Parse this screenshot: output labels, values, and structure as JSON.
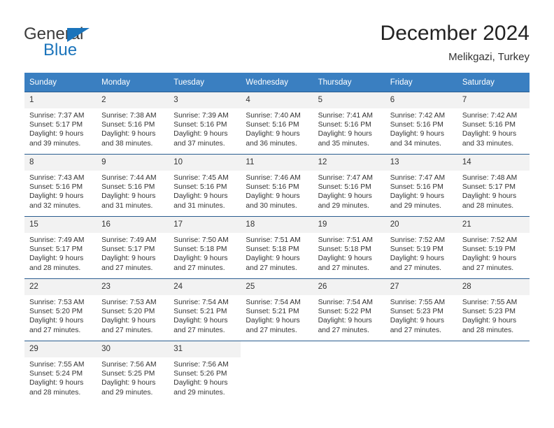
{
  "brand": {
    "name_top": "General",
    "name_bottom": "Blue",
    "top_color": "#3b3b3b",
    "accent_color": "#1b74bb",
    "triangle_icon": "triangle-right-icon"
  },
  "header": {
    "title": "December 2024",
    "subtitle": "Melikgazi, Turkey"
  },
  "theme": {
    "header_bg": "#3a7fc1",
    "header_text": "#ffffff",
    "daynum_bg": "#f2f2f2",
    "row_rule": "#2a5d8f",
    "body_text": "#333333"
  },
  "calendar": {
    "weekday_headers": [
      "Sunday",
      "Monday",
      "Tuesday",
      "Wednesday",
      "Thursday",
      "Friday",
      "Saturday"
    ],
    "weeks": [
      [
        {
          "day": "1",
          "sunrise": "Sunrise: 7:37 AM",
          "sunset": "Sunset: 5:17 PM",
          "daylight_1": "Daylight: 9 hours",
          "daylight_2": "and 39 minutes."
        },
        {
          "day": "2",
          "sunrise": "Sunrise: 7:38 AM",
          "sunset": "Sunset: 5:16 PM",
          "daylight_1": "Daylight: 9 hours",
          "daylight_2": "and 38 minutes."
        },
        {
          "day": "3",
          "sunrise": "Sunrise: 7:39 AM",
          "sunset": "Sunset: 5:16 PM",
          "daylight_1": "Daylight: 9 hours",
          "daylight_2": "and 37 minutes."
        },
        {
          "day": "4",
          "sunrise": "Sunrise: 7:40 AM",
          "sunset": "Sunset: 5:16 PM",
          "daylight_1": "Daylight: 9 hours",
          "daylight_2": "and 36 minutes."
        },
        {
          "day": "5",
          "sunrise": "Sunrise: 7:41 AM",
          "sunset": "Sunset: 5:16 PM",
          "daylight_1": "Daylight: 9 hours",
          "daylight_2": "and 35 minutes."
        },
        {
          "day": "6",
          "sunrise": "Sunrise: 7:42 AM",
          "sunset": "Sunset: 5:16 PM",
          "daylight_1": "Daylight: 9 hours",
          "daylight_2": "and 34 minutes."
        },
        {
          "day": "7",
          "sunrise": "Sunrise: 7:42 AM",
          "sunset": "Sunset: 5:16 PM",
          "daylight_1": "Daylight: 9 hours",
          "daylight_2": "and 33 minutes."
        }
      ],
      [
        {
          "day": "8",
          "sunrise": "Sunrise: 7:43 AM",
          "sunset": "Sunset: 5:16 PM",
          "daylight_1": "Daylight: 9 hours",
          "daylight_2": "and 32 minutes."
        },
        {
          "day": "9",
          "sunrise": "Sunrise: 7:44 AM",
          "sunset": "Sunset: 5:16 PM",
          "daylight_1": "Daylight: 9 hours",
          "daylight_2": "and 31 minutes."
        },
        {
          "day": "10",
          "sunrise": "Sunrise: 7:45 AM",
          "sunset": "Sunset: 5:16 PM",
          "daylight_1": "Daylight: 9 hours",
          "daylight_2": "and 31 minutes."
        },
        {
          "day": "11",
          "sunrise": "Sunrise: 7:46 AM",
          "sunset": "Sunset: 5:16 PM",
          "daylight_1": "Daylight: 9 hours",
          "daylight_2": "and 30 minutes."
        },
        {
          "day": "12",
          "sunrise": "Sunrise: 7:47 AM",
          "sunset": "Sunset: 5:16 PM",
          "daylight_1": "Daylight: 9 hours",
          "daylight_2": "and 29 minutes."
        },
        {
          "day": "13",
          "sunrise": "Sunrise: 7:47 AM",
          "sunset": "Sunset: 5:16 PM",
          "daylight_1": "Daylight: 9 hours",
          "daylight_2": "and 29 minutes."
        },
        {
          "day": "14",
          "sunrise": "Sunrise: 7:48 AM",
          "sunset": "Sunset: 5:17 PM",
          "daylight_1": "Daylight: 9 hours",
          "daylight_2": "and 28 minutes."
        }
      ],
      [
        {
          "day": "15",
          "sunrise": "Sunrise: 7:49 AM",
          "sunset": "Sunset: 5:17 PM",
          "daylight_1": "Daylight: 9 hours",
          "daylight_2": "and 28 minutes."
        },
        {
          "day": "16",
          "sunrise": "Sunrise: 7:49 AM",
          "sunset": "Sunset: 5:17 PM",
          "daylight_1": "Daylight: 9 hours",
          "daylight_2": "and 27 minutes."
        },
        {
          "day": "17",
          "sunrise": "Sunrise: 7:50 AM",
          "sunset": "Sunset: 5:18 PM",
          "daylight_1": "Daylight: 9 hours",
          "daylight_2": "and 27 minutes."
        },
        {
          "day": "18",
          "sunrise": "Sunrise: 7:51 AM",
          "sunset": "Sunset: 5:18 PM",
          "daylight_1": "Daylight: 9 hours",
          "daylight_2": "and 27 minutes."
        },
        {
          "day": "19",
          "sunrise": "Sunrise: 7:51 AM",
          "sunset": "Sunset: 5:18 PM",
          "daylight_1": "Daylight: 9 hours",
          "daylight_2": "and 27 minutes."
        },
        {
          "day": "20",
          "sunrise": "Sunrise: 7:52 AM",
          "sunset": "Sunset: 5:19 PM",
          "daylight_1": "Daylight: 9 hours",
          "daylight_2": "and 27 minutes."
        },
        {
          "day": "21",
          "sunrise": "Sunrise: 7:52 AM",
          "sunset": "Sunset: 5:19 PM",
          "daylight_1": "Daylight: 9 hours",
          "daylight_2": "and 27 minutes."
        }
      ],
      [
        {
          "day": "22",
          "sunrise": "Sunrise: 7:53 AM",
          "sunset": "Sunset: 5:20 PM",
          "daylight_1": "Daylight: 9 hours",
          "daylight_2": "and 27 minutes."
        },
        {
          "day": "23",
          "sunrise": "Sunrise: 7:53 AM",
          "sunset": "Sunset: 5:20 PM",
          "daylight_1": "Daylight: 9 hours",
          "daylight_2": "and 27 minutes."
        },
        {
          "day": "24",
          "sunrise": "Sunrise: 7:54 AM",
          "sunset": "Sunset: 5:21 PM",
          "daylight_1": "Daylight: 9 hours",
          "daylight_2": "and 27 minutes."
        },
        {
          "day": "25",
          "sunrise": "Sunrise: 7:54 AM",
          "sunset": "Sunset: 5:21 PM",
          "daylight_1": "Daylight: 9 hours",
          "daylight_2": "and 27 minutes."
        },
        {
          "day": "26",
          "sunrise": "Sunrise: 7:54 AM",
          "sunset": "Sunset: 5:22 PM",
          "daylight_1": "Daylight: 9 hours",
          "daylight_2": "and 27 minutes."
        },
        {
          "day": "27",
          "sunrise": "Sunrise: 7:55 AM",
          "sunset": "Sunset: 5:23 PM",
          "daylight_1": "Daylight: 9 hours",
          "daylight_2": "and 27 minutes."
        },
        {
          "day": "28",
          "sunrise": "Sunrise: 7:55 AM",
          "sunset": "Sunset: 5:23 PM",
          "daylight_1": "Daylight: 9 hours",
          "daylight_2": "and 28 minutes."
        }
      ],
      [
        {
          "day": "29",
          "sunrise": "Sunrise: 7:55 AM",
          "sunset": "Sunset: 5:24 PM",
          "daylight_1": "Daylight: 9 hours",
          "daylight_2": "and 28 minutes."
        },
        {
          "day": "30",
          "sunrise": "Sunrise: 7:56 AM",
          "sunset": "Sunset: 5:25 PM",
          "daylight_1": "Daylight: 9 hours",
          "daylight_2": "and 29 minutes."
        },
        {
          "day": "31",
          "sunrise": "Sunrise: 7:56 AM",
          "sunset": "Sunset: 5:26 PM",
          "daylight_1": "Daylight: 9 hours",
          "daylight_2": "and 29 minutes."
        },
        {
          "day": "",
          "sunrise": "",
          "sunset": "",
          "daylight_1": "",
          "daylight_2": ""
        },
        {
          "day": "",
          "sunrise": "",
          "sunset": "",
          "daylight_1": "",
          "daylight_2": ""
        },
        {
          "day": "",
          "sunrise": "",
          "sunset": "",
          "daylight_1": "",
          "daylight_2": ""
        },
        {
          "day": "",
          "sunrise": "",
          "sunset": "",
          "daylight_1": "",
          "daylight_2": ""
        }
      ]
    ]
  }
}
